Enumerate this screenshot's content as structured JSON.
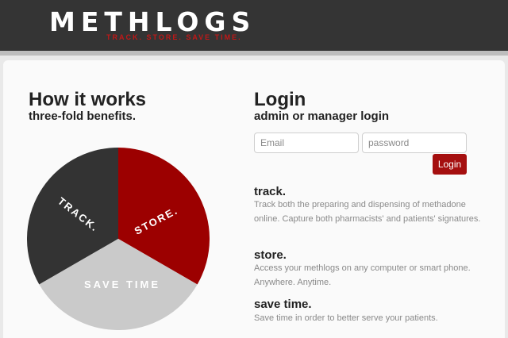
{
  "brand": {
    "name": "METHLOGS",
    "tagline": "TRACK.  STORE.  SAVE TIME."
  },
  "how": {
    "title": "How it works",
    "subtitle": "three-fold benefits."
  },
  "pie": {
    "track_label": "TRACK.",
    "store_label": "STORE.",
    "save_label": "SAVE TIME",
    "colors": {
      "track": "#333333",
      "store": "#9c0000",
      "save": "#cacaca"
    }
  },
  "login": {
    "title": "Login",
    "subtitle": "admin or manager login",
    "email_placeholder": "Email",
    "password_placeholder": "password",
    "button_label": "Login"
  },
  "features": [
    {
      "title": "track.",
      "desc": "Track both the preparing and dispensing of methadone online. Capture both pharmacists' and patients' signatures."
    },
    {
      "title": "store.",
      "desc": "Access your methlogs on any computer or smart phone. Anywhere. Anytime."
    },
    {
      "title": "save time.",
      "desc": "Save time in order to better serve your patients."
    }
  ]
}
